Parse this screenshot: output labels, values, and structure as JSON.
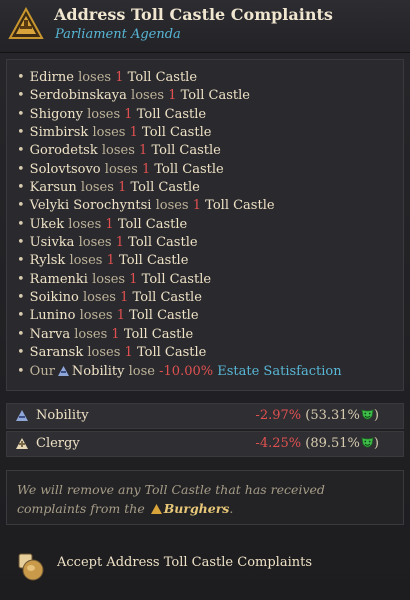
{
  "header": {
    "title": "Address Toll Castle Complaints",
    "subtitle": "Parliament Agenda",
    "icon": "parliament-warning-icon"
  },
  "effects": {
    "verb": "loses",
    "amount": "1",
    "building": "Toll Castle",
    "places": [
      "Edirne",
      "Serdobinskaya",
      "Shigony",
      "Simbirsk",
      "Gorodetsk",
      "Solovtsovo",
      "Karsun",
      "Velyki Sorochyntsi",
      "Ukek",
      "Usivka",
      "Rylsk",
      "Ramenki",
      "Soikino",
      "Lunino",
      "Narva",
      "Saransk"
    ],
    "final": {
      "prefix": "Our",
      "estate": "Nobility",
      "verb": "lose",
      "value": "-10.00%",
      "target": "Estate Satisfaction"
    }
  },
  "estates": [
    {
      "name": "Nobility",
      "change": "-2.97%",
      "open": "(",
      "current": "53.31%",
      "close": ")",
      "icon": "nobility-icon"
    },
    {
      "name": "Clergy",
      "change": "-4.25%",
      "open": "(",
      "current": "89.51%",
      "close": ")",
      "icon": "clergy-icon"
    }
  ],
  "note": {
    "text": "We will remove any Toll Castle that has received complaints from the",
    "estate": "Burghers",
    "end": "."
  },
  "accept": {
    "label": "Accept Address Toll Castle Complaints"
  },
  "colors": {
    "negative": "#e05050",
    "link": "#58b7d6",
    "happy": "#3fbf4a"
  }
}
